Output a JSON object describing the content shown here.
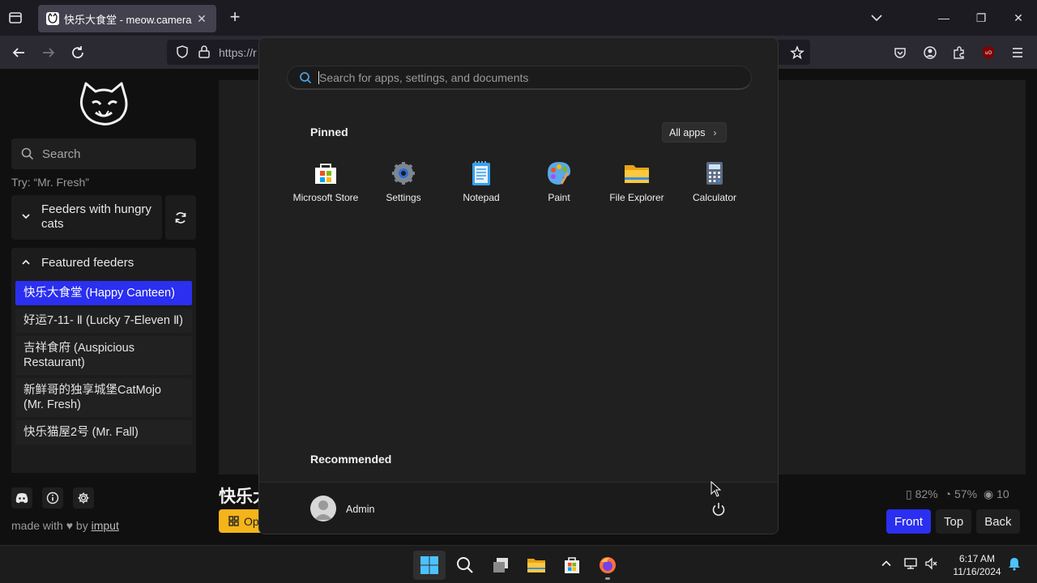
{
  "browser": {
    "tab_title": "快乐大食堂 - meow.camera",
    "url_partial": "https://r"
  },
  "sidebar": {
    "search_placeholder": "Search",
    "try_hint": "Try: “Mr. Fresh”",
    "group_hungry": "Feeders with hungry cats",
    "group_featured": "Featured feeders",
    "feeders": [
      "快乐大食堂 (Happy Canteen)",
      "好运7-11- Ⅱ (Lucky 7-Eleven Ⅱ)",
      "吉祥食府 (Auspicious Restaurant)",
      "新鲜哥的独享城堡CatMojo (Mr. Fresh)",
      "快乐猫屋2号 (Mr. Fall)"
    ],
    "made_with": "made with",
    "by": "by",
    "author": "imput"
  },
  "main": {
    "camera_title_partial": "快乐大",
    "open_button_partial": "Op",
    "stats": {
      "battery": "82%",
      "food": "57%",
      "viewers": "10"
    },
    "views": [
      "Front",
      "Top",
      "Back"
    ],
    "selected_view": "Front"
  },
  "start_menu": {
    "search_placeholder": "Search for apps, settings, and documents",
    "pinned_heading": "Pinned",
    "all_apps_label": "All apps",
    "pinned_apps": [
      {
        "name": "Microsoft Store",
        "icon": "microsoft-store-icon"
      },
      {
        "name": "Settings",
        "icon": "settings-gear-icon"
      },
      {
        "name": "Notepad",
        "icon": "notepad-icon"
      },
      {
        "name": "Paint",
        "icon": "paint-palette-icon"
      },
      {
        "name": "File Explorer",
        "icon": "folder-icon"
      },
      {
        "name": "Calculator",
        "icon": "calculator-icon"
      }
    ],
    "recommended_heading": "Recommended",
    "user_name": "Admin"
  },
  "taskbar": {
    "time": "6:17 AM",
    "date": "11/16/2024"
  },
  "colors": {
    "accent_blue": "#2b2ff0",
    "open_button": "#f4b41a",
    "start_bg": "#202020"
  }
}
